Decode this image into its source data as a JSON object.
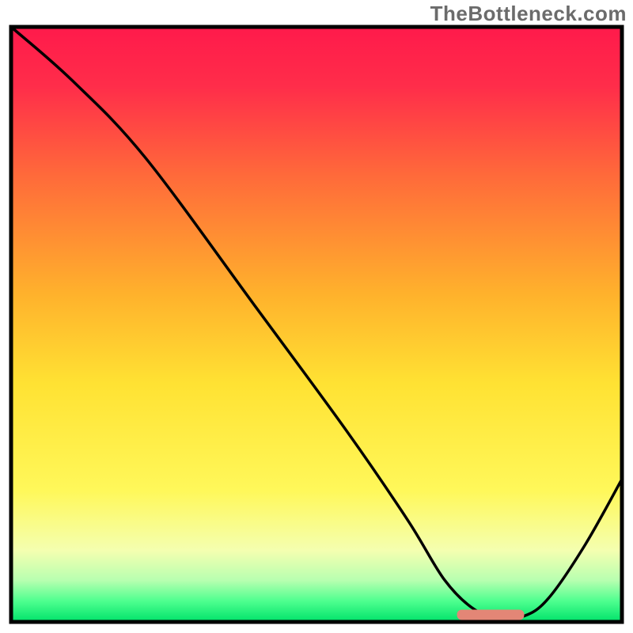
{
  "watermark": "TheBottleneck.com",
  "chart_data": {
    "type": "line",
    "title": "",
    "xlabel": "",
    "ylabel": "",
    "xlim": [
      0,
      100
    ],
    "ylim": [
      0,
      100
    ],
    "x": [
      0,
      10,
      22,
      40,
      55,
      65,
      71,
      76,
      80,
      84,
      88,
      94,
      100
    ],
    "values": [
      100,
      91,
      78,
      53,
      32,
      17,
      7,
      2,
      1,
      1,
      4,
      13,
      24
    ],
    "optimum_band": {
      "x_start": 73,
      "x_end": 84,
      "y": 1.2
    },
    "gradient_stops": [
      {
        "offset": 0.0,
        "color": "#ff1a4b"
      },
      {
        "offset": 0.1,
        "color": "#ff2d4a"
      },
      {
        "offset": 0.25,
        "color": "#ff6a3a"
      },
      {
        "offset": 0.45,
        "color": "#ffb22c"
      },
      {
        "offset": 0.6,
        "color": "#ffe233"
      },
      {
        "offset": 0.78,
        "color": "#fff85a"
      },
      {
        "offset": 0.88,
        "color": "#f4ffb0"
      },
      {
        "offset": 0.93,
        "color": "#b8ffb0"
      },
      {
        "offset": 0.965,
        "color": "#4eff8f"
      },
      {
        "offset": 1.0,
        "color": "#00e26a"
      }
    ],
    "curve_color": "#000000",
    "border_color": "#000000",
    "optimum_color": "#e38676"
  }
}
